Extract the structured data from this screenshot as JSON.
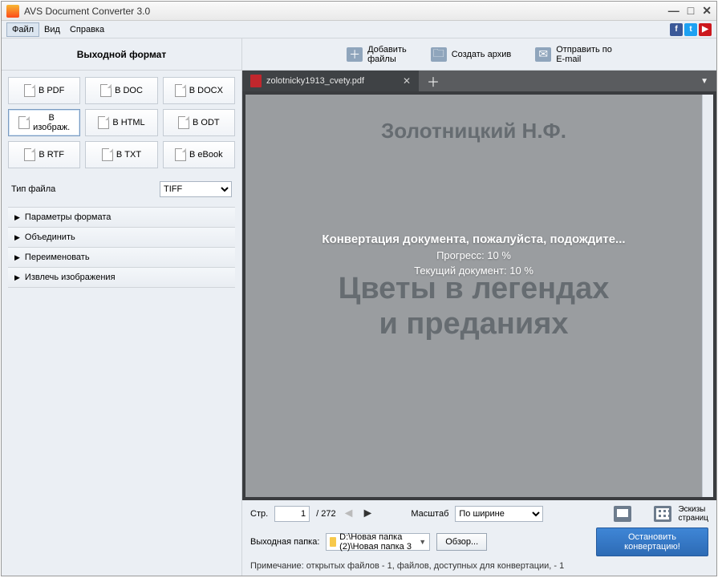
{
  "window": {
    "title": "AVS Document Converter 3.0"
  },
  "menu": {
    "file": "Файл",
    "view": "Вид",
    "help": "Справка"
  },
  "toolbar": {
    "add_files": "Добавить\nфайлы",
    "create_archive": "Создать архив",
    "send_email": "Отправить по\nE-mail"
  },
  "sidebar": {
    "header": "Выходной формат",
    "formats": {
      "pdf": "В PDF",
      "doc": "В DOC",
      "docx": "В DOCX",
      "image": "В\nизображ.",
      "html": "В HTML",
      "odt": "В ODT",
      "rtf": "В RTF",
      "txt": "В TXT",
      "ebook": "В eBook"
    },
    "file_type_label": "Тип файла",
    "file_type_value": "TIFF",
    "accordion": {
      "format_params": "Параметры формата",
      "merge": "Объединить",
      "rename": "Переименовать",
      "extract_images": "Извлечь изображения"
    }
  },
  "tab": {
    "filename": "zolotnicky1913_cvety.pdf"
  },
  "document": {
    "author": "Золотницкий Н.Ф.",
    "title_line1": "Цветы в легендах",
    "title_line2": "и преданиях"
  },
  "overlay": {
    "line1": "Конвертация документа, пожалуйста, подождите...",
    "progress": "Прогресс: 10 %",
    "current": "Текущий документ: 10 %"
  },
  "footer": {
    "page_label": "Стр.",
    "page_current": "1",
    "page_total": "/ 272",
    "zoom_label": "Масштаб",
    "zoom_value": "По ширине",
    "thumbs": "Эскизы\nстраниц",
    "out_folder_label": "Выходная папка:",
    "out_folder_path": "D:\\Новая папка (2)\\Новая папка 3",
    "browse": "Обзор...",
    "stop_line1": "Остановить",
    "stop_line2": "конвертацию!",
    "note": "Примечание: открытых файлов - 1, файлов, доступных для конвертации, - 1"
  }
}
